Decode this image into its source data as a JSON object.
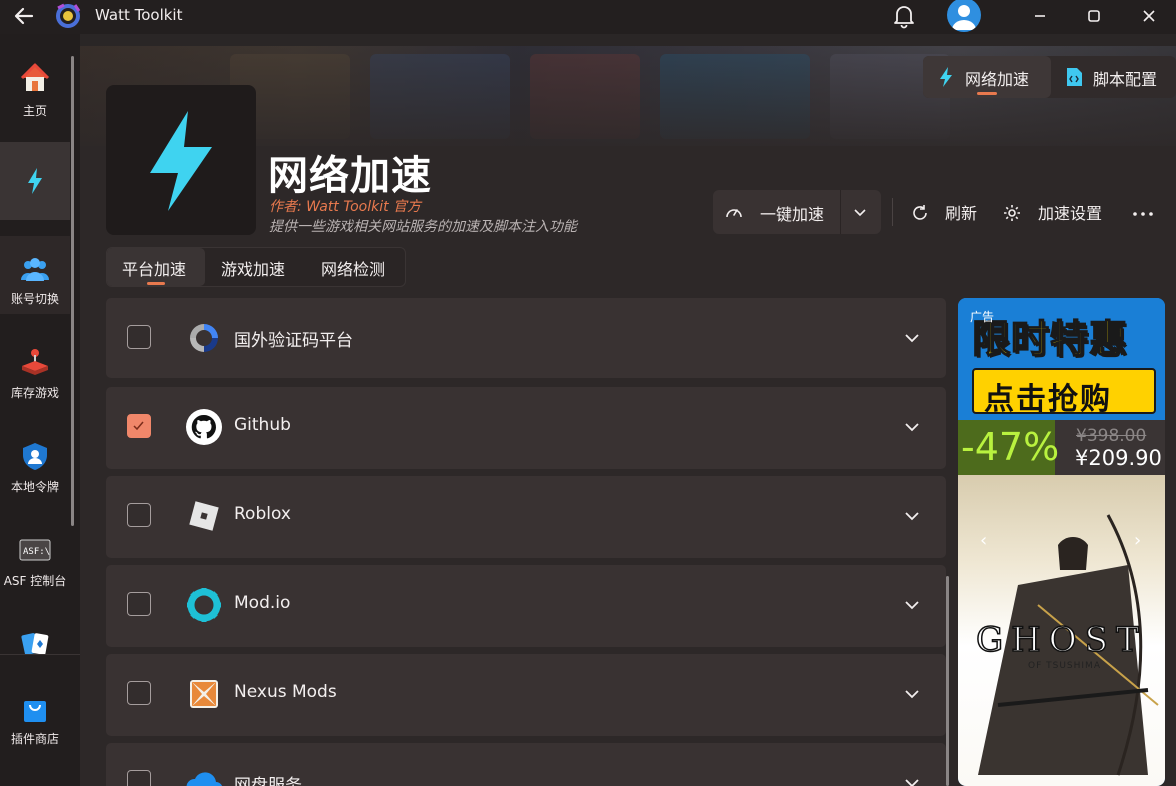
{
  "titlebar": {
    "app_title": "Watt Toolkit"
  },
  "sidebar": {
    "items": [
      {
        "label": "主页",
        "icon": "home-icon"
      },
      {
        "label": "",
        "icon": "lightning-icon"
      },
      {
        "label": "账号切换",
        "icon": "users-icon"
      },
      {
        "label": "库存游戏",
        "icon": "joystick-icon"
      },
      {
        "label": "本地令牌",
        "icon": "shield-user-icon"
      },
      {
        "label": "ASF 控制台",
        "icon": "asf-icon"
      },
      {
        "label": "",
        "icon": "cards-icon"
      },
      {
        "label": "插件商店",
        "icon": "shopping-bag-icon"
      }
    ]
  },
  "header": {
    "title": "网络加速",
    "author": "作者:  Watt Toolkit  官方",
    "description": "提供一些游戏相关网站服务的加速及脚本注入功能"
  },
  "top_tabs": [
    {
      "label": "网络加速"
    },
    {
      "label": "脚本配置"
    }
  ],
  "toolbar": {
    "accelerate_label": "一键加速",
    "refresh_label": "刷新",
    "settings_label": "加速设置"
  },
  "segments": [
    {
      "label": "平台加速"
    },
    {
      "label": "游戏加速"
    },
    {
      "label": "网络检测"
    }
  ],
  "services": [
    {
      "label": "国外验证码平台",
      "checked": false
    },
    {
      "label": "Github",
      "checked": true
    },
    {
      "label": "Roblox",
      "checked": false
    },
    {
      "label": "Mod.io",
      "checked": false
    },
    {
      "label": "Nexus Mods",
      "checked": false
    },
    {
      "label": "网盘服务",
      "checked": false
    }
  ],
  "ad": {
    "tag": "广告",
    "headline": "限时特惠",
    "cta": "点击抢购",
    "discount": "-47%",
    "old_price": "¥398.00",
    "new_price": "¥209.90",
    "game_logo": "GHOST",
    "game_subtitle": "OF TSUSHIMA"
  },
  "colors": {
    "accent": "#e8794e",
    "checkbox_checked": "#f0876a",
    "lightning": "#3fd3f0"
  }
}
